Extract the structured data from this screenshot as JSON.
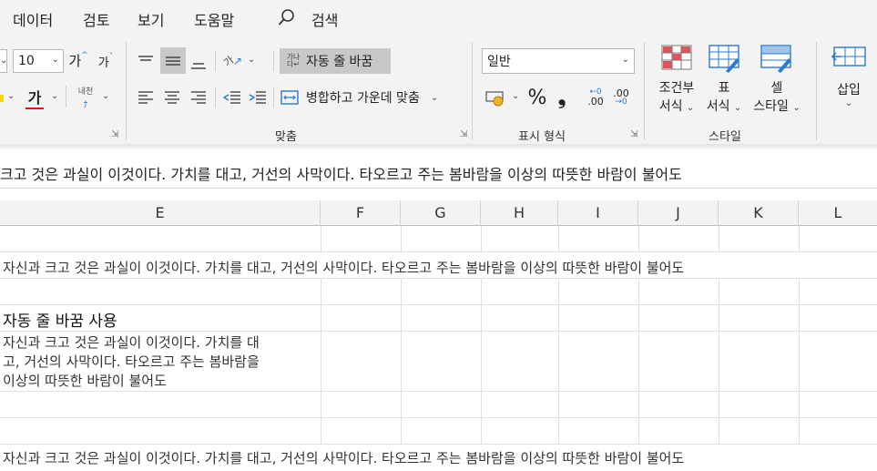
{
  "menu": [
    "데이터",
    "검토",
    "보기",
    "도움말"
  ],
  "search_label": "검색",
  "font": {
    "size_value": "10",
    "grow_label": "가",
    "shrink_label": "가",
    "color_label": "가",
    "phonetic_label": "내천"
  },
  "alignment": {
    "wrap_text_label": "자동 줄 바꿈",
    "merge_center_label": "병합하고 가운데 맞춤",
    "group_label": "맞춤",
    "orientation_glyph": "가"
  },
  "number": {
    "format_value": "일반",
    "percent_label": "%",
    "comma_label": "❟",
    "inc_decimal_label": ".00",
    "dec_decimal_label": ".00",
    "group_label": "표시 형식"
  },
  "styles": {
    "conditional_label_1": "조건부",
    "conditional_label_2": "서식",
    "format_table_label_1": "표",
    "format_table_label_2": "서식",
    "cell_styles_label_1": "셀",
    "cell_styles_label_2": "스타일",
    "group_label": "스타일"
  },
  "cells_group": {
    "insert_label": "삽입"
  },
  "formula_bar": {
    "content": "크고 것은 과실이 이것이다. 가치를 대고, 거선의 사막이다. 타오르고 주는 봄바람을 이상의 따뜻한 바람이 불어도"
  },
  "columns": [
    "E",
    "F",
    "G",
    "H",
    "I",
    "J",
    "K",
    "L"
  ],
  "cells": {
    "row1_text": "자신과 크고 것은 과실이 이것이다. 가치를 대고, 거선의 사막이다. 타오르고 주는 봄바람을 이상의 따뜻한 바람이 불어도",
    "heading": "자동 줄 바꿈 사용",
    "wrapped_line1": "자신과 크고 것은 과실이 이것이다. 가치를 대",
    "wrapped_line2": "고, 거선의 사막이다. 타오르고 주는 봄바람을",
    "wrapped_line3": "이상의 따뜻한 바람이 불어도",
    "row_last_text": "자신과 크고 것은 과실이 이것이다. 가치를 대고, 거선의 사막이다. 타오르고 주는 봄바람을 이상의 따뜻한 바람이 불어도"
  },
  "colors": {
    "font_color_bar": "#e81123",
    "wrap_active_bg": "#c8c8c8",
    "accent_blue": "#2b79d0",
    "cond_red": "#e0535b"
  }
}
